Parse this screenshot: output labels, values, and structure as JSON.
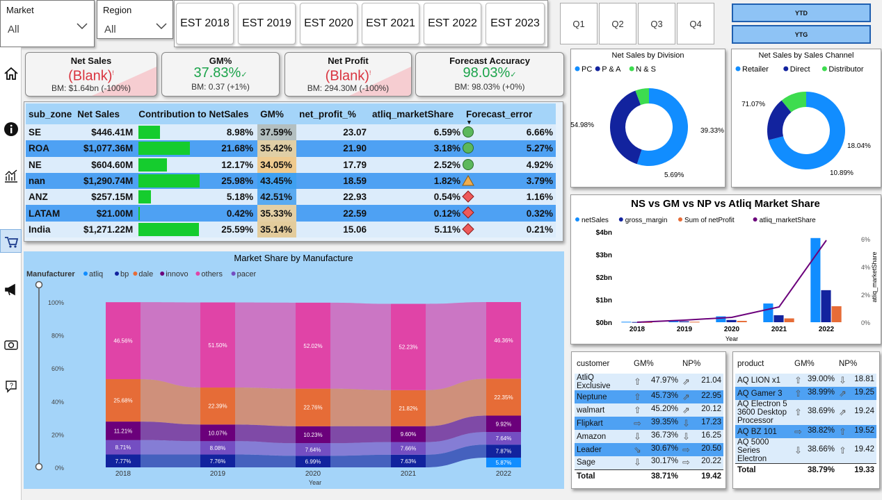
{
  "filters": {
    "market": {
      "label": "Market",
      "value": "All"
    },
    "region": {
      "label": "Region",
      "value": "All"
    }
  },
  "est_buttons": [
    "EST 2018",
    "EST 2019",
    "EST 2020",
    "EST 2021",
    "EST 2022",
    "EST 2023"
  ],
  "quarters": [
    "Q1",
    "Q2",
    "Q3",
    "Q4"
  ],
  "period_buttons": [
    "YTD",
    "YTG"
  ],
  "sidebar_icons": [
    "home-icon",
    "info-icon",
    "finance-chart-icon",
    "sales-icon",
    "marketing-icon",
    "supply-chain-icon",
    "support-icon"
  ],
  "kpis": [
    {
      "title": "Net Sales",
      "value": "(Blank)",
      "mark": "!",
      "bm": "BM: $1.64bn (-100%)",
      "status": "red"
    },
    {
      "title": "GM%",
      "value": "37.83%",
      "mark": "✓",
      "bm": "BM: 0.37 (+1%)",
      "status": "green"
    },
    {
      "title": "Net Profit",
      "value": "(Blank)",
      "mark": "!",
      "bm": "BM: 294.30M (-100%)",
      "status": "red"
    },
    {
      "title": "Forecast Accuracy",
      "value": "98.03%",
      "mark": "✓",
      "bm": "BM: 98.03% (+0%)",
      "status": "green"
    }
  ],
  "main_table": {
    "headers": [
      "sub_zone",
      "Net Sales",
      "Contribution to NetSales",
      "GM%",
      "net_profit_%",
      "atliq_marketShare",
      "Forecast_error"
    ],
    "rows": [
      {
        "zone": "SE",
        "sales": "$446.41M",
        "contrib": "8.98%",
        "contrib_v": 8.98,
        "gm": "37.59%",
        "gm_color": "#b3bfc0",
        "np": "23.07",
        "ms": "6.59%",
        "icon": "circle",
        "fe": "6.66%"
      },
      {
        "zone": "ROA",
        "sales": "$1,077.36M",
        "contrib": "21.68%",
        "contrib_v": 21.68,
        "gm": "35.42%",
        "gm_color": "#e0cfa6",
        "np": "21.90",
        "ms": "3.18%",
        "icon": "circle",
        "fe": "5.27%"
      },
      {
        "zone": "NE",
        "sales": "$604.60M",
        "contrib": "12.17%",
        "contrib_v": 12.17,
        "gm": "34.05%",
        "gm_color": "#efca8e",
        "np": "17.79",
        "ms": "2.52%",
        "icon": "circle",
        "fe": "4.92%"
      },
      {
        "zone": "nan",
        "sales": "$1,290.74M",
        "contrib": "25.98%",
        "contrib_v": 25.98,
        "gm": "43.45%",
        "gm_color": "#3fa0f1",
        "np": "18.59",
        "ms": "1.82%",
        "icon": "triangle",
        "fe": "3.79%"
      },
      {
        "zone": "ANZ",
        "sales": "$257.15M",
        "contrib": "5.18%",
        "contrib_v": 5.18,
        "gm": "42.51%",
        "gm_color": "#5aaaf0",
        "np": "22.93",
        "ms": "0.54%",
        "icon": "diamond",
        "fe": "1.16%"
      },
      {
        "zone": "LATAM",
        "sales": "$21.00M",
        "contrib": "0.42%",
        "contrib_v": 0.42,
        "gm": "35.33%",
        "gm_color": "#e4cfa4",
        "np": "22.59",
        "ms": "0.12%",
        "icon": "diamond",
        "fe": "0.32%"
      },
      {
        "zone": "India",
        "sales": "$1,271.22M",
        "contrib": "25.59%",
        "contrib_v": 25.59,
        "gm": "35.14%",
        "gm_color": "#e3cc9c",
        "np": "15.06",
        "ms": "5.11%",
        "icon": "diamond",
        "fe": "0.21%"
      }
    ]
  },
  "colors": {
    "pc": "#118dff",
    "pa": "#12239e",
    "ns": "#3ddc4f",
    "retailer": "#118dff",
    "direct": "#12239e",
    "distributor": "#3ddc4f",
    "gross_margin": "#12239e",
    "netprofit": "#e66c37",
    "marketshare": "#6b007b"
  },
  "chart_data": [
    {
      "type": "pie",
      "title": "Net Sales by Division",
      "legend": [
        "PC",
        "P & A",
        "N & S"
      ],
      "values": [
        54.98,
        39.33,
        5.69
      ],
      "labels": [
        "54.98%",
        "39.33%",
        "5.69%"
      ]
    },
    {
      "type": "pie",
      "title": "Net Sales by Sales Channel",
      "legend": [
        "Retailer",
        "Direct",
        "Distributor"
      ],
      "values": [
        71.07,
        18.04,
        10.89
      ],
      "labels": [
        "71.07%",
        "18.04%",
        "10.89%"
      ]
    },
    {
      "type": "bar",
      "title": "NS vs GM vs NP vs Atliq Market Share",
      "legend": [
        "netSales",
        "gross_margin",
        "Sum of netProfit",
        "atliq_marketShare"
      ],
      "categories": [
        "2018",
        "2019",
        "2020",
        "2021",
        "2022"
      ],
      "xlabel": "Year",
      "ylabel_right": "atliq_marketShare",
      "y_ticks": [
        "$0bn",
        "$1bn",
        "$2bn",
        "$3bn",
        "$4bn"
      ],
      "y2_ticks": [
        "0%",
        "2%",
        "4%",
        "6%"
      ],
      "series": [
        {
          "name": "netSales",
          "values": [
            0.02,
            0.09,
            0.26,
            0.83,
            3.73
          ]
        },
        {
          "name": "gross_margin",
          "values": [
            0.01,
            0.04,
            0.1,
            0.31,
            1.42
          ]
        },
        {
          "name": "Sum of netProfit",
          "values": [
            0.005,
            0.02,
            0.06,
            0.17,
            0.71
          ]
        },
        {
          "name": "atliq_marketShare",
          "values": [
            0.0,
            0.15,
            0.35,
            1.1,
            5.9
          ]
        }
      ],
      "ylim": [
        0,
        4
      ],
      "y2lim": [
        0,
        6.5
      ]
    },
    {
      "type": "area",
      "title": "Market Share by Manufacture",
      "legend_title": "Manufacturer",
      "legend": [
        "atliq",
        "bp",
        "dale",
        "innovo",
        "others",
        "pacer"
      ],
      "categories": [
        "2018",
        "2019",
        "2020",
        "2021",
        "2022"
      ],
      "xlabel": "Year",
      "y_ticks": [
        "0%",
        "20%",
        "40%",
        "60%",
        "80%",
        "100%"
      ],
      "series": [
        {
          "name": "atliq",
          "values": [
            null,
            null,
            null,
            null,
            5.87
          ]
        },
        {
          "name": "bp",
          "values": [
            7.77,
            7.76,
            6.99,
            7.63,
            7.87
          ]
        },
        {
          "name": "pacer",
          "values": [
            8.71,
            8.08,
            7.64,
            7.66,
            7.64
          ]
        },
        {
          "name": "innovo",
          "values": [
            11.21,
            10.07,
            10.23,
            9.6,
            9.92
          ]
        },
        {
          "name": "dale",
          "values": [
            25.68,
            22.39,
            22.76,
            21.82,
            22.35
          ]
        },
        {
          "name": "others",
          "values": [
            46.56,
            51.5,
            52.02,
            52.23,
            46.36
          ]
        }
      ]
    }
  ],
  "customer_table": {
    "headers": [
      "customer",
      "GM%",
      "NP%"
    ],
    "rows": [
      [
        "AtliQ Exclusive",
        "47.97%",
        "21.04",
        "⇧",
        "⇗"
      ],
      [
        "Neptune",
        "45.73%",
        "22.95",
        "⇧",
        "⇗"
      ],
      [
        "walmart",
        "45.20%",
        "20.12",
        "⇧",
        "⇗"
      ],
      [
        "Flipkart",
        "39.35%",
        "17.23",
        "⇨",
        "⇩"
      ],
      [
        "Amazon",
        "36.73%",
        "16.25",
        "⇩",
        "⇩"
      ],
      [
        "Leader",
        "30.67%",
        "20.50",
        "⇘",
        "⇨"
      ],
      [
        "Sage",
        "30.17%",
        "20.22",
        "⇩",
        "⇨"
      ]
    ],
    "total": [
      "Total",
      "38.71%",
      "19.42"
    ]
  },
  "product_table": {
    "headers": [
      "product",
      "GM%",
      "NP%"
    ],
    "rows": [
      [
        "AQ LION x1",
        "39.00%",
        "18.81",
        "⇧",
        "⇩"
      ],
      [
        "AQ Gamer 3",
        "38.99%",
        "19.25",
        "⇧",
        "⇗"
      ],
      [
        "AQ Electron 5 3600 Desktop Processor",
        "38.69%",
        "19.24",
        "⇧",
        "⇗"
      ],
      [
        "AQ BZ 101",
        "38.82%",
        "19.52",
        "⇨",
        "⇧"
      ],
      [
        "AQ 5000 Series Electron",
        "38.66%",
        "19.42",
        "⇩",
        "⇧"
      ]
    ],
    "total": [
      "Total",
      "38.79%",
      "19.33"
    ]
  }
}
